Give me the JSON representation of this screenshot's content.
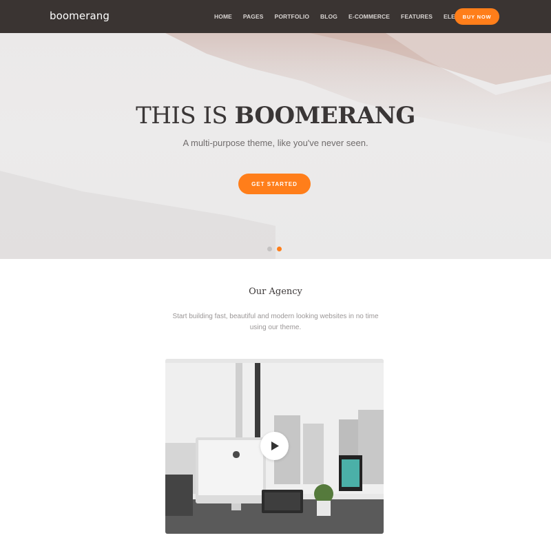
{
  "navbar": {
    "logo": "boomerang",
    "links": [
      "HOME",
      "PAGES",
      "PORTFOLIO",
      "BLOG",
      "E-COMMERCE",
      "FEATURES",
      "ELEMENTS"
    ],
    "buy_button": "BUY NOW"
  },
  "hero": {
    "title_light": "THIS IS ",
    "title_bold": "BOOMERANG",
    "subtitle": "A multi-purpose theme, like you've never seen.",
    "cta": "GET STARTED",
    "slides_count": 2,
    "active_slide": 2
  },
  "agency": {
    "title": "Our Agency",
    "description": "Start building fast, beautiful and modern looking websites in no time using our theme."
  },
  "video": {
    "play_icon": "play-icon"
  },
  "colors": {
    "accent": "#ff7e1a",
    "navbar_bg": "#3a3432"
  }
}
